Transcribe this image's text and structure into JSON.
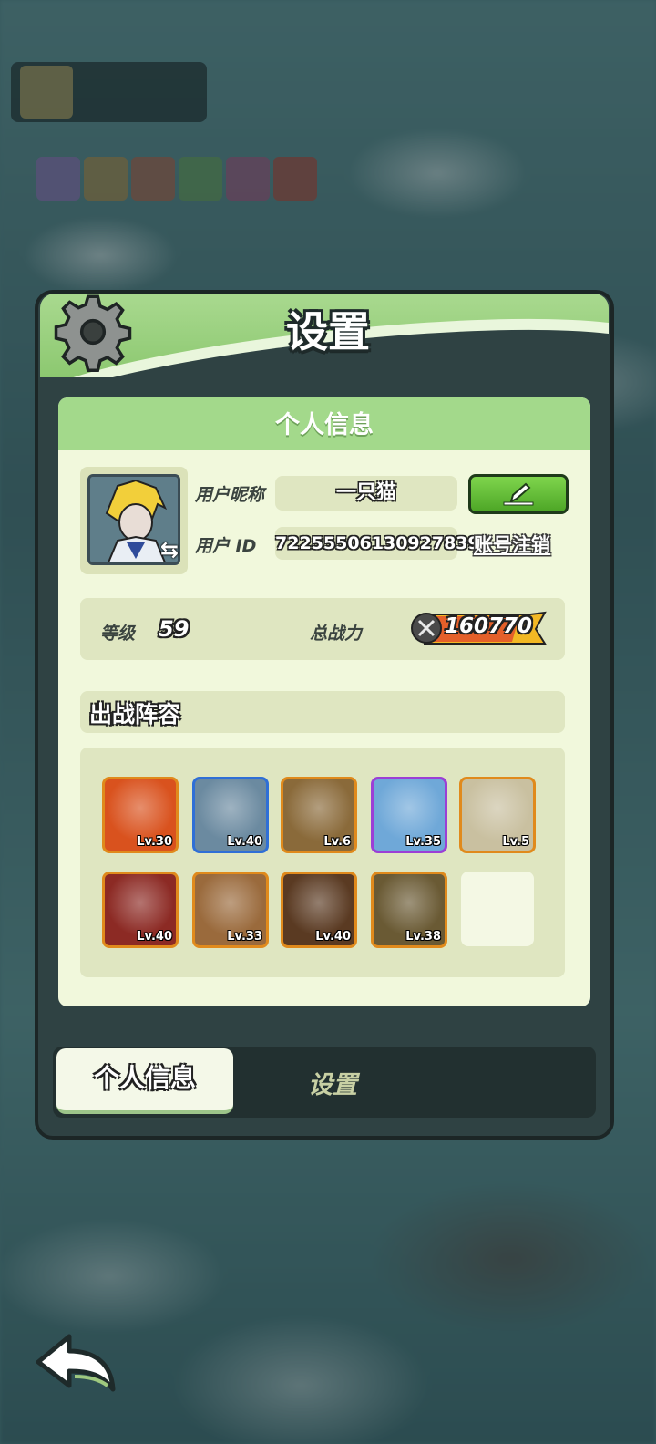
{
  "panel": {
    "title": "设置"
  },
  "personal": {
    "section_title": "个人信息",
    "nickname_label": "用户昵称",
    "nickname_value": "一只猫",
    "id_label": "用户  ID",
    "id_value": "72255506130927839",
    "logout_label": "账号注销"
  },
  "stats": {
    "level_label": "等级",
    "level_value": "59",
    "power_label": "总战力",
    "power_value": "160770"
  },
  "lineup": {
    "title": "出战阵容",
    "heroes": [
      {
        "level": "Lv.30",
        "frame": "orange",
        "color": "#d9521e"
      },
      {
        "level": "Lv.40",
        "frame": "blue",
        "color": "#6b8aa0"
      },
      {
        "level": "Lv.6",
        "frame": "orange",
        "color": "#8a6a3a"
      },
      {
        "level": "Lv.35",
        "frame": "purple",
        "color": "#6fa8d8"
      },
      {
        "level": "Lv.5",
        "frame": "orange",
        "color": "#c9c0a0"
      },
      {
        "level": "Lv.40",
        "frame": "orange",
        "color": "#8c2a24"
      },
      {
        "level": "Lv.33",
        "frame": "orange",
        "color": "#9a6a3c"
      },
      {
        "level": "Lv.40",
        "frame": "orange",
        "color": "#5a3a22"
      },
      {
        "level": "Lv.38",
        "frame": "orange",
        "color": "#6a5a34"
      }
    ]
  },
  "tabs": {
    "personal": "个人信息",
    "settings": "设置"
  },
  "icons": {
    "gear": "gear-icon",
    "edit": "pencil-icon",
    "back": "back-arrow-icon",
    "power": "swords-icon"
  },
  "colors": {
    "accent_green": "#8cc870",
    "panel_dark": "#2f4243",
    "content_bg": "#f1f8dc"
  }
}
